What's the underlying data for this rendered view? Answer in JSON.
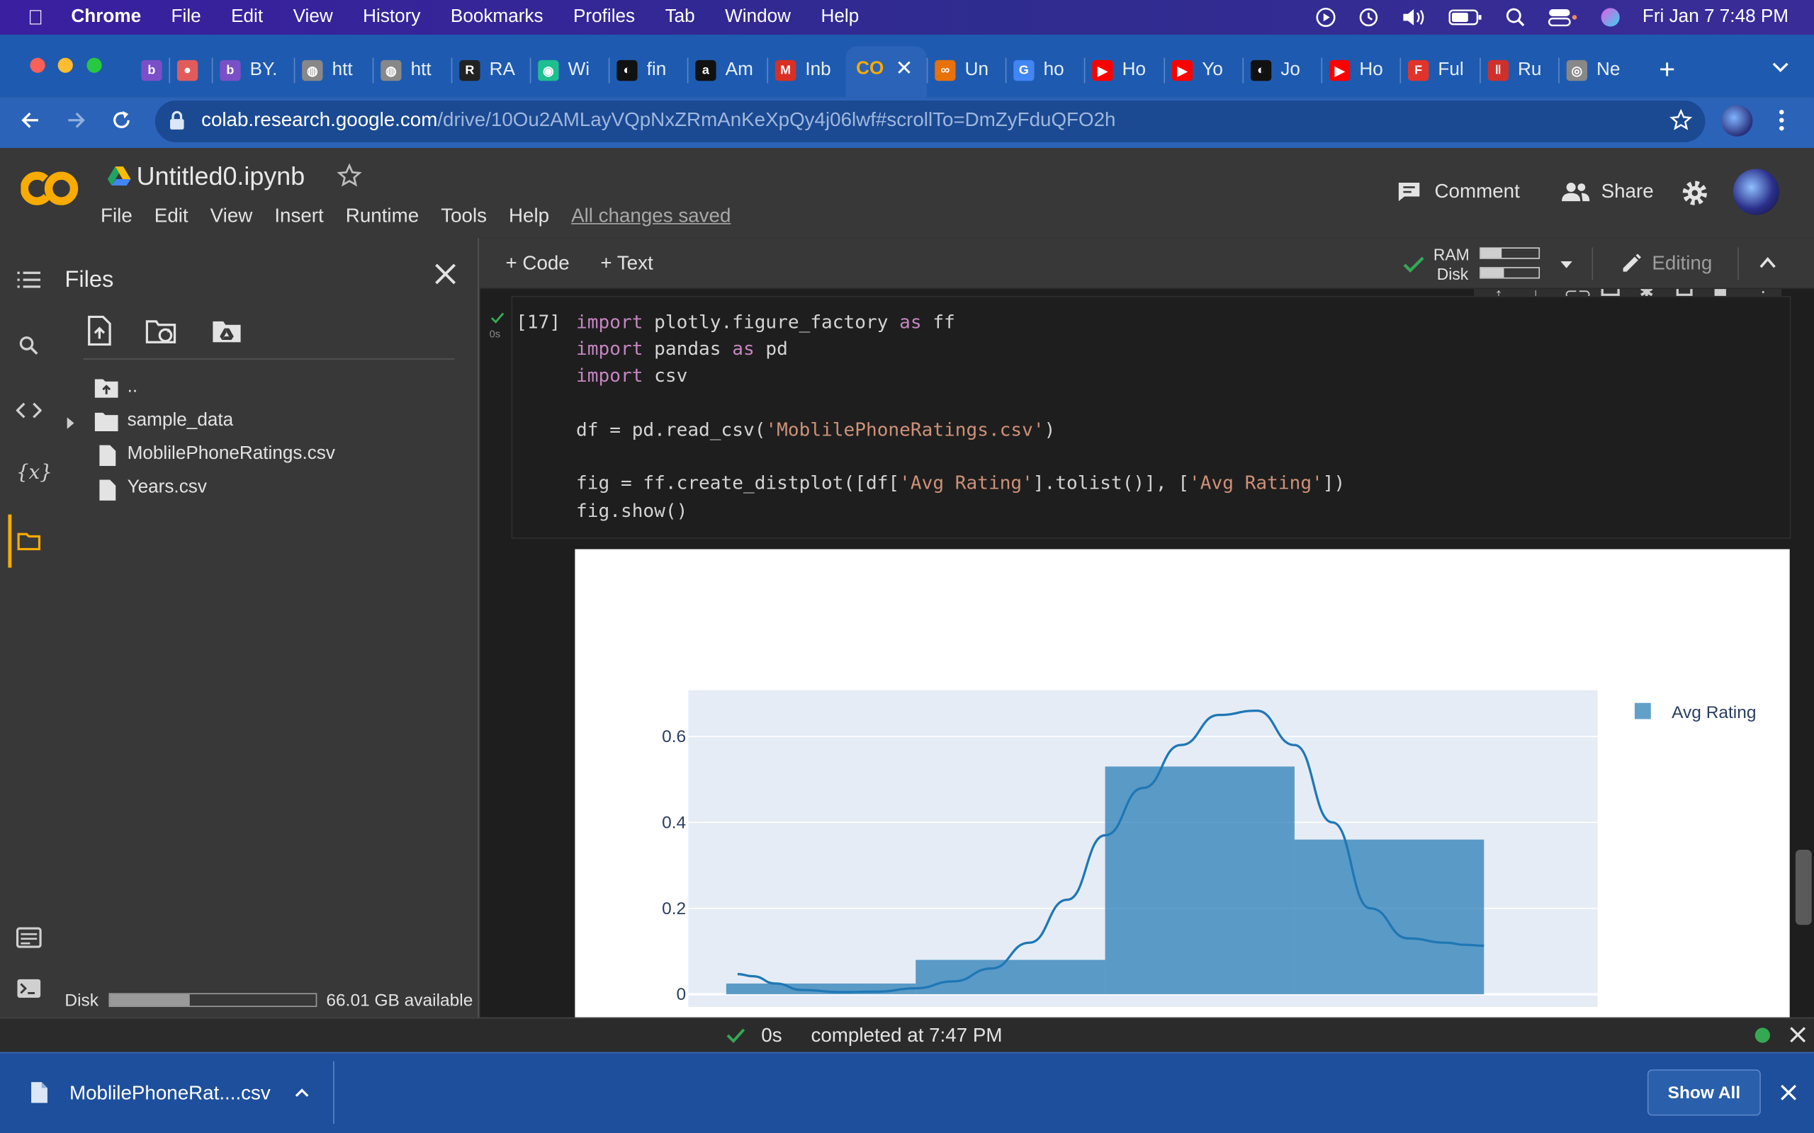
{
  "menubar": {
    "app": "Chrome",
    "items": [
      "File",
      "Edit",
      "View",
      "History",
      "Bookmarks",
      "Profiles",
      "Tab",
      "Window",
      "Help"
    ],
    "clock": "Fri Jan 7  7:48 PM"
  },
  "tabs": [
    {
      "label": "",
      "icon": "tab-favicon-b-icon",
      "color": "#7a4fc7",
      "glyph": "b"
    },
    {
      "label": "",
      "icon": "tab-favicon-record-icon",
      "color": "#e25b5b",
      "glyph": "●"
    },
    {
      "label": "BY.",
      "icon": "tab-favicon-b2-icon",
      "color": "#7a4fc7",
      "glyph": "b"
    },
    {
      "label": "htt",
      "icon": "tab-favicon-globe-icon",
      "color": "#888888",
      "glyph": "◍"
    },
    {
      "label": "htt",
      "icon": "tab-favicon-globe2-icon",
      "color": "#888888",
      "glyph": "◍"
    },
    {
      "label": "RA",
      "icon": "tab-favicon-r-icon",
      "color": "#222222",
      "glyph": "R"
    },
    {
      "label": "Wi",
      "icon": "tab-favicon-chat-icon",
      "color": "#1fbf8f",
      "glyph": "◉"
    },
    {
      "label": "fin",
      "icon": "tab-favicon-github-icon",
      "color": "#111111",
      "glyph": "◐"
    },
    {
      "label": "Am",
      "icon": "tab-favicon-amazon-icon",
      "color": "#111111",
      "glyph": "a"
    },
    {
      "label": "Inb",
      "icon": "tab-favicon-gmail-icon",
      "color": "#d93025",
      "glyph": "M"
    },
    {
      "label": "Un",
      "icon": "tab-favicon-colab2-icon",
      "color": "#e8710a",
      "glyph": "∞"
    },
    {
      "label": "ho",
      "icon": "tab-favicon-google-icon",
      "color": "#4285f4",
      "glyph": "G"
    },
    {
      "label": "Ho",
      "icon": "tab-favicon-youtube-icon",
      "color": "#ff0000",
      "glyph": "▶"
    },
    {
      "label": "Yo",
      "icon": "tab-favicon-youtube2-icon",
      "color": "#ff0000",
      "glyph": "▶"
    },
    {
      "label": "Jo",
      "icon": "tab-favicon-github2-icon",
      "color": "#111111",
      "glyph": "◐"
    },
    {
      "label": "Ho",
      "icon": "tab-favicon-youtube3-icon",
      "color": "#ff0000",
      "glyph": "▶"
    },
    {
      "label": "Ful",
      "icon": "tab-favicon-fk-icon",
      "color": "#e0342b",
      "glyph": "F"
    },
    {
      "label": "Ru",
      "icon": "tab-favicon-bars-icon",
      "color": "#d0302b",
      "glyph": "‖"
    },
    {
      "label": "Ne",
      "icon": "tab-favicon-chrome-icon",
      "color": "#888888",
      "glyph": "◎"
    }
  ],
  "address": {
    "host": "colab.research.google.com",
    "path": "/drive/10Ou2AMLayVQpNxZRmAnKeXpQy4j06lwf#scrollTo=DmZyFduQFO2h"
  },
  "colab": {
    "title": "Untitled0.ipynb",
    "menus": [
      "File",
      "Edit",
      "View",
      "Insert",
      "Runtime",
      "Tools",
      "Help"
    ],
    "saved": "All changes saved",
    "comment": "Comment",
    "share": "Share",
    "add_code": "Code",
    "add_text": "Text",
    "ram": "RAM",
    "disk": "Disk",
    "editing": "Editing"
  },
  "files": {
    "title": "Files",
    "items": [
      "..",
      "sample_data",
      "MoblilePhoneRatings.csv",
      "Years.csv"
    ],
    "disk_label": "Disk",
    "disk_available": "66.01 GB available",
    "disk_used_fraction": 0.39
  },
  "cell": {
    "count": "[17]",
    "exec_time": "0s"
  },
  "statusbar": {
    "time": "0s",
    "message": "completed at 7:47 PM"
  },
  "downloads": {
    "file": "MoblilePhoneRat....csv",
    "show_all": "Show All"
  },
  "chart_data": {
    "type": "bar",
    "title": "",
    "xlabel": "",
    "ylabel": "",
    "ylim": [
      0,
      0.7
    ],
    "yticks": [
      0,
      0.2,
      0.4,
      0.6
    ],
    "xlim": [
      2.0,
      4.4
    ],
    "legend": "top-right",
    "series": [
      {
        "name": "Avg Rating",
        "type": "histogram",
        "bins": [
          {
            "x0": 2.1,
            "x1": 2.6,
            "y": 0.025
          },
          {
            "x0": 2.6,
            "x1": 3.1,
            "y": 0.08
          },
          {
            "x0": 3.1,
            "x1": 3.6,
            "y": 0.53
          },
          {
            "x0": 3.6,
            "x1": 4.1,
            "y": 0.36
          }
        ]
      },
      {
        "name": "Avg Rating",
        "type": "line",
        "x": [
          2.13,
          2.17,
          2.23,
          2.3,
          2.4,
          2.5,
          2.6,
          2.7,
          2.8,
          2.9,
          3.0,
          3.1,
          3.2,
          3.3,
          3.4,
          3.5,
          3.6,
          3.7,
          3.8,
          3.9,
          4.0,
          4.05,
          4.1
        ],
        "y": [
          0.047,
          0.042,
          0.025,
          0.01,
          0.005,
          0.006,
          0.014,
          0.03,
          0.06,
          0.12,
          0.22,
          0.37,
          0.48,
          0.58,
          0.65,
          0.66,
          0.58,
          0.4,
          0.2,
          0.13,
          0.12,
          0.115,
          0.113
        ]
      }
    ]
  }
}
